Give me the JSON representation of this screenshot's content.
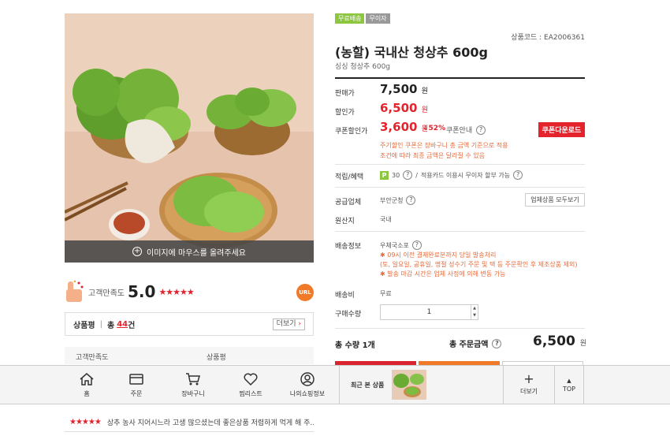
{
  "gallery": {
    "hint": "이미지에 마우스를 올려주세요"
  },
  "rating": {
    "label": "고객만족도",
    "score": "5.0",
    "stars": "★★★★★",
    "url_label": "URL"
  },
  "reviews": {
    "title": "상품평",
    "count_prefix": "총",
    "count": "44",
    "count_suffix": "건",
    "more_label": "더보기",
    "col_satisfaction": "고객만족도",
    "col_review": "상품평",
    "first_row": {
      "stars": "★★★★★",
      "text": "상추 농사 지어시느라 고생 많으셨는데 좋은상품 저렴하게 먹게 해 주..."
    }
  },
  "product": {
    "badges": [
      "무료배송",
      "무이자"
    ],
    "code": "상품코드 : EA2006361",
    "title": "(농할) 국내산 청상추 600g",
    "subtitle": "싱싱 청상추 600g",
    "list_price_label": "판매가",
    "list_price": "7,500",
    "won": "원",
    "sale_price_label": "할인가",
    "sale_price": "6,500",
    "coupon_price_label": "쿠폰할인가",
    "coupon_price": "3,600",
    "coupon_pct": "↓52%",
    "coupon_info_label": "쿠폰안내",
    "coupon_download": "쿠폰다운로드",
    "coupon_note_1": "주기할인 쿠폰은 장바구니 총 금액 기준으로 적용",
    "coupon_note_2": "조건에 따라 최종 금액은 달라질 수 있음",
    "points_label": "적립/혜택",
    "points_value": "30",
    "points_card": "적용카드 이용시 무이자 할부 가능",
    "vendor_label": "공급업체",
    "vendor": "부안군청",
    "vendor_button": "업체상품 모두보기",
    "origin_label": "원산지",
    "origin": "국내",
    "shipping_label": "배송정보",
    "shipping_method": "우체국소포",
    "shipping_note_1": "✱ 09시 이전 결제완료분까지 당일 발송처리",
    "shipping_note_2": "(토, 일요일, 공휴일, 명절 성수기 주문 및 택 등 주문확인 후 제조상품 제외)",
    "shipping_note_3": "✱ 발송 마감 시간은 업체 사정에 의해 변동 가능",
    "shipping_fee_label": "배송비",
    "shipping_fee": "무료",
    "quantity_label": "구매수량",
    "quantity": "1",
    "total_qty_label": "총 수량 1개",
    "total_amount_label": "총 주문금액",
    "total_amount": "6,500",
    "total_unit": "원"
  },
  "bottom_nav": {
    "items": [
      {
        "label": "홈",
        "icon": "home-icon"
      },
      {
        "label": "주문",
        "icon": "card-icon"
      },
      {
        "label": "장바구니",
        "icon": "cart-icon"
      },
      {
        "label": "찜리스트",
        "icon": "heart-icon"
      },
      {
        "label": "나의쇼핑정보",
        "icon": "user-icon"
      }
    ],
    "recent_label": "최근 본 상품",
    "more_label": "더보기",
    "top_label": "TOP"
  },
  "colors": {
    "accent_red": "#e4232d",
    "note_orange": "#e86a3a",
    "badge_green": "#8dc63f"
  }
}
